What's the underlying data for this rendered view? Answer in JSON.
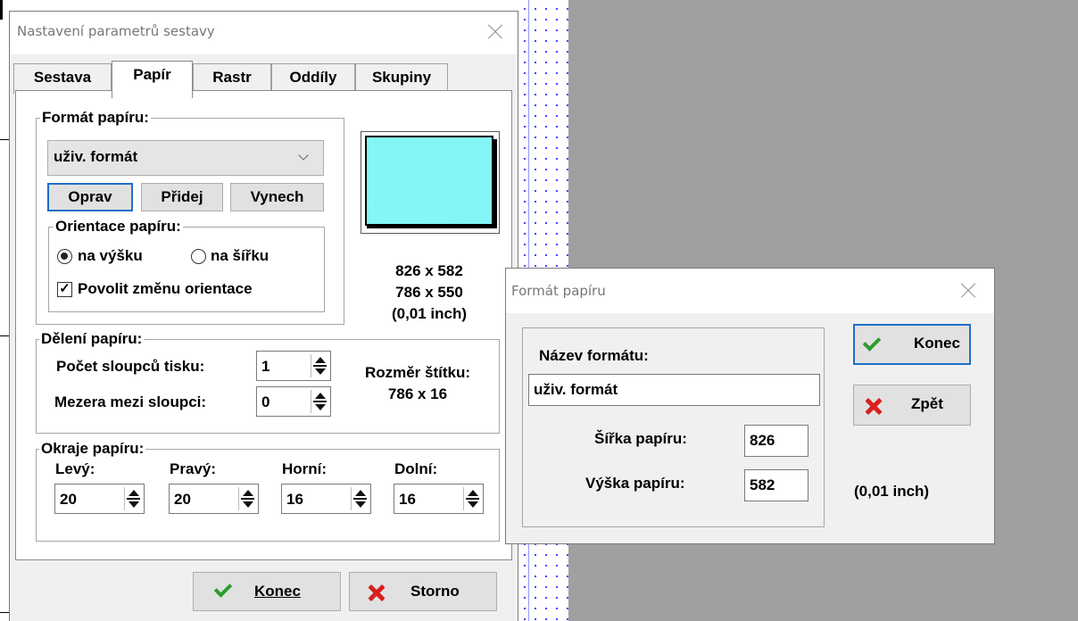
{
  "main_dialog": {
    "title": "Nastavení parametrů sestavy",
    "tabs": [
      "Sestava",
      "Papír",
      "Rastr",
      "Oddíly",
      "Skupiny"
    ],
    "active_tab": "Papír",
    "paper_format": {
      "group_label": "Formát papíru:",
      "selected": "uživ. formát",
      "buttons": {
        "edit": "Oprav",
        "add": "Přidej",
        "remove": "Vynech"
      },
      "orientation": {
        "group_label": "Orientace papíru:",
        "portrait": "na výšku",
        "landscape": "na šířku",
        "selected": "portrait",
        "allow_change_label": "Povolit změnu orientace",
        "allow_change_checked": true
      }
    },
    "preview": {
      "size_total": "826 x 582",
      "size_printable": "786 x 550",
      "unit": "(0,01 inch)"
    },
    "paper_division": {
      "group_label": "Dělení papíru:",
      "columns_label": "Počet sloupců tisku:",
      "columns_value": "1",
      "gap_label": "Mezera mezi sloupci:",
      "gap_value": "0",
      "label_size_title": "Rozměr štítku:",
      "label_size_value": "786 x 16"
    },
    "margins": {
      "group_label": "Okraje papíru:",
      "left_label": "Levý:",
      "left_value": "20",
      "right_label": "Pravý:",
      "right_value": "20",
      "top_label": "Horní:",
      "top_value": "16",
      "bottom_label": "Dolní:",
      "bottom_value": "16"
    },
    "footer": {
      "ok_label": "Konec",
      "cancel_label": "Storno"
    }
  },
  "format_dialog": {
    "title": "Formát papíru",
    "name_label": "Název formátu:",
    "name_value": "uživ. formát",
    "width_label": "Šířka papíru:",
    "width_value": "826",
    "height_label": "Výška papíru:",
    "height_value": "582",
    "unit": "(0,01 inch)",
    "ok_label": "Konec",
    "back_label": "Zpět"
  },
  "colors": {
    "accent_focus": "#1f6fc9",
    "preview_fill": "#7cf5f5",
    "check_green": "#2e9b2e",
    "cross_red": "#d82020",
    "workspace_gray": "#a0a0a0"
  }
}
